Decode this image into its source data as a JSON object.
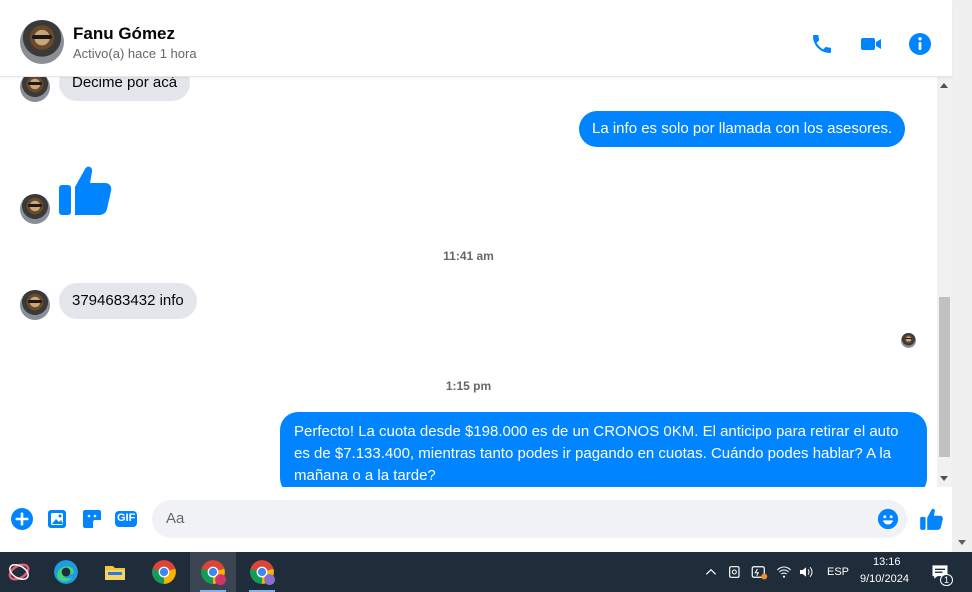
{
  "contact": {
    "name": "Fanu Gómez",
    "status": "Activo(a) hace 1 hora"
  },
  "messages": [
    {
      "side": "in",
      "text": "Decime por acá"
    },
    {
      "side": "out",
      "text": "La info es solo por llamada con los asesores."
    },
    {
      "side": "in",
      "type": "like-sticker"
    },
    {
      "type": "timestamp",
      "text": "11:41 am"
    },
    {
      "side": "in",
      "text": "3794683432 info"
    },
    {
      "type": "timestamp",
      "text": "1:15 pm"
    },
    {
      "side": "out",
      "text": "Perfecto! La cuota desde $198.000 es de un CRONOS 0KM. El anticipo para retirar el auto es de $7.133.400, mientras tanto podes ir pagando en cuotas. Cuándo podes hablar? A la mañana o a la tarde?"
    }
  ],
  "composer": {
    "placeholder": "Aa",
    "gif_label": "GIF"
  },
  "taskbar": {
    "language": "ESP",
    "time": "13:16",
    "date": "9/10/2024",
    "notification_count": "1"
  },
  "colors": {
    "accent": "#0084ff",
    "incoming_bubble": "#e4e6eb",
    "taskbar": "#1f2c3a"
  }
}
